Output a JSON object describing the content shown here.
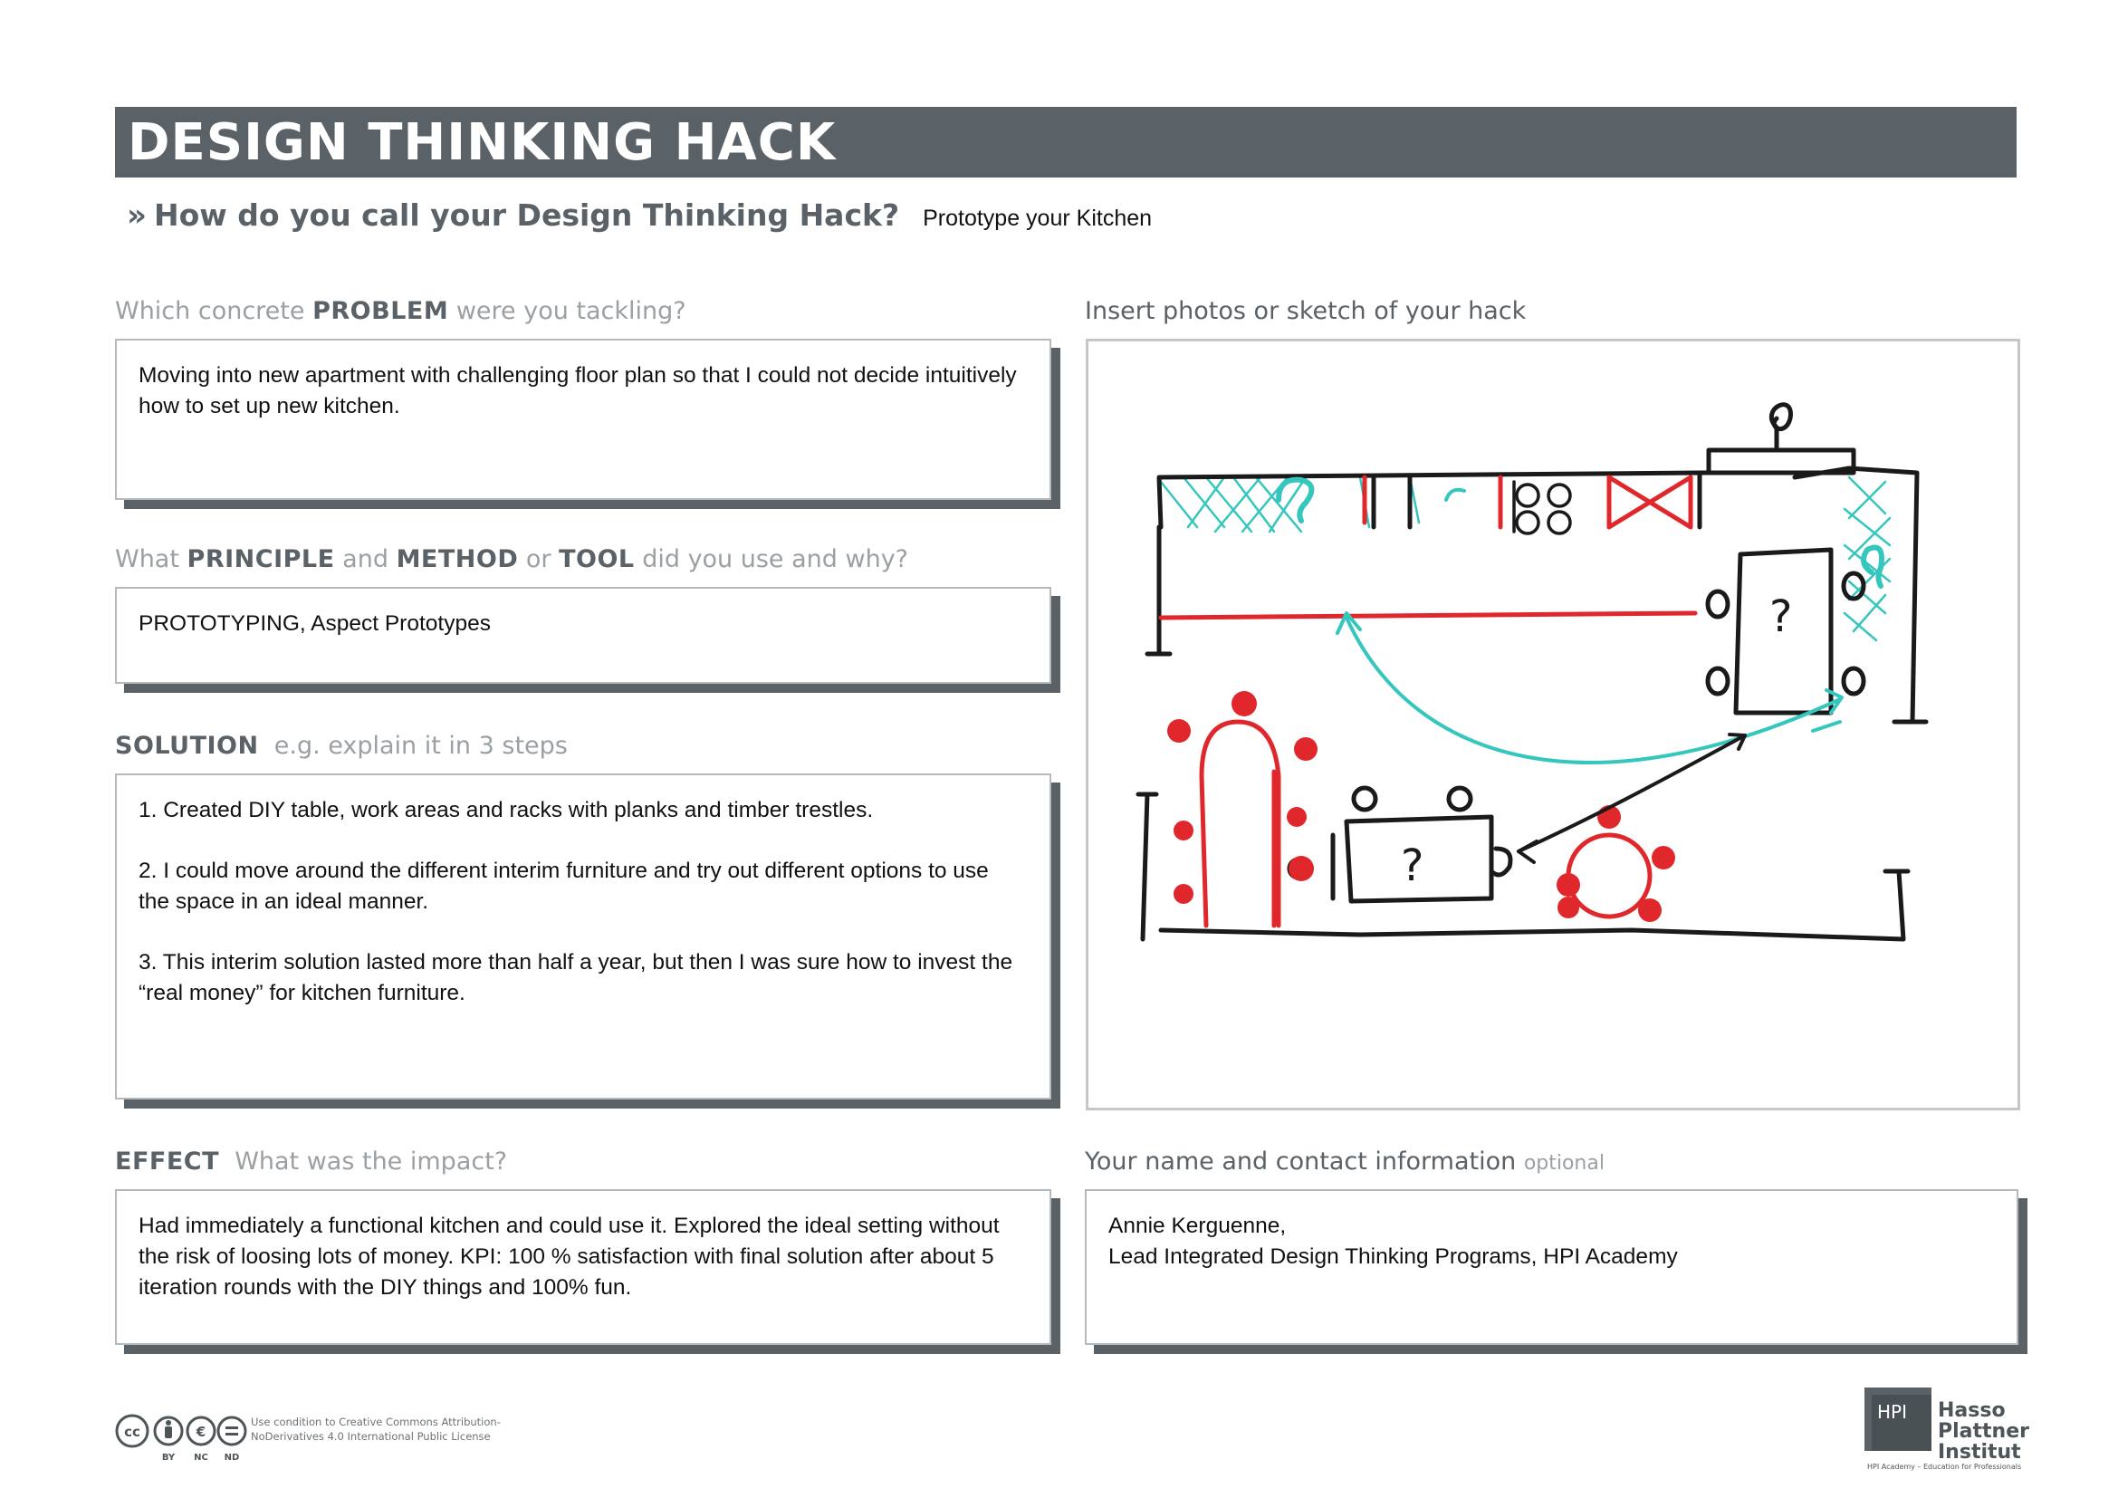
{
  "header": {
    "title": "DESIGN THINKING HACK",
    "question_marker": "»",
    "question": "How do you call your Design Thinking Hack?",
    "answer": "Prototype your Kitchen"
  },
  "problem": {
    "label_pre": "Which concrete",
    "label_strong": "PROBLEM",
    "label_post": "were you tackling?",
    "text": "Moving into new apartment with challenging floor plan so that I could not decide intuitively how to set up new kitchen."
  },
  "principle": {
    "label_pre": "What",
    "label_strong1": "PRINCIPLE",
    "label_and": "and",
    "label_strong2": "METHOD",
    "label_or": "or",
    "label_strong3": "TOOL",
    "label_post": "did you use and why?",
    "text": "PROTOTYPING, Aspect Prototypes"
  },
  "solution": {
    "label_strong": "SOLUTION",
    "label_post": "e.g. explain it in 3 steps",
    "steps": [
      "1. Created DIY table, work areas and racks with planks and timber trestles.",
      "2. I could move around the different interim furniture and try out different options to use the space in an ideal manner.",
      "3. This interim solution lasted more than half a year, but then I was sure how to invest the “real money” for kitchen furniture."
    ]
  },
  "effect": {
    "label_strong": "EFFECT",
    "label_post": "What was the impact?",
    "text": "Had immediately a functional kitchen and could use it. Explored the ideal setting without the risk of loosing lots of money. KPI: 100 % satisfaction with final solution after about 5 iteration rounds with the DIY things and 100% fun."
  },
  "photo": {
    "label": "Insert photos or sketch of your hack",
    "sketch_marks": [
      "?",
      "?",
      "?"
    ]
  },
  "contact": {
    "label": "Your name and contact information",
    "label_optional": "optional",
    "line1": "Annie Kerguenne,",
    "line2": "Lead Integrated Design Thinking Programs, HPI Academy"
  },
  "footer": {
    "cc_badges": [
      "BY",
      "NC",
      "ND"
    ],
    "license_text": "Use condition to Creative Commons Attribution-NoDerivatives 4.0 International Public License",
    "hpi_mark": "HPI",
    "hpi_name_1": "Hasso",
    "hpi_name_2": "Plattner",
    "hpi_name_3": "Institut",
    "hpi_sub": "HPI Academy – Education for Professionals"
  },
  "colors": {
    "banner": "#5a6267",
    "sketch_red": "#e0282c",
    "sketch_teal": "#35c6bd",
    "sketch_black": "#1a1a1a"
  }
}
